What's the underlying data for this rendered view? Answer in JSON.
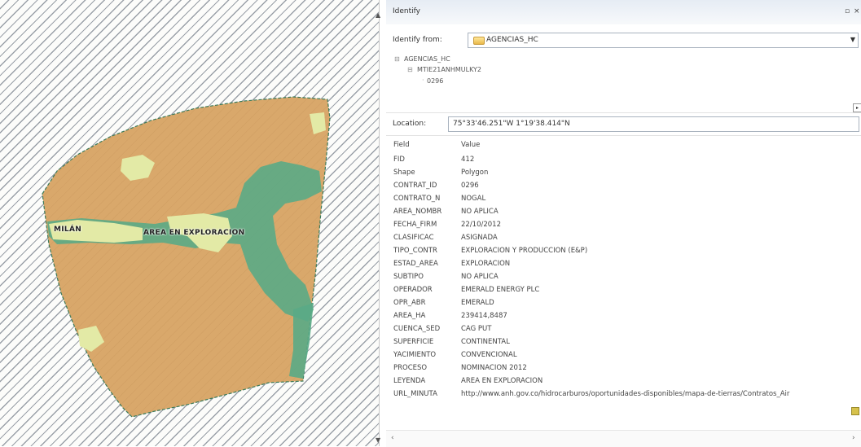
{
  "map": {
    "labels": {
      "milan": "MILÁN",
      "area": "AREA EN EXPLORACION"
    },
    "colors": {
      "area_fill": "#d9a86b",
      "green": "#5aaa86",
      "light_green": "#e3eaa6",
      "hatch": "#9aa0a8"
    }
  },
  "panel": {
    "title": "Identify",
    "pin_icon": "pin-icon",
    "close_icon": "close-icon",
    "identify_from_label": "Identify from:",
    "identify_from_value": "AGENCIAS_HC",
    "tree": {
      "layer": "AGENCIAS_HC",
      "feature": "MTIE21ANHMULKY2",
      "value": "0296"
    },
    "location_label": "Location:",
    "location_value": "75°33'46.251\"W  1°19'38.414\"N",
    "table": {
      "header": {
        "field": "Field",
        "value": "Value"
      },
      "rows": [
        {
          "field": "FID",
          "value": "412"
        },
        {
          "field": "Shape",
          "value": "Polygon"
        },
        {
          "field": "CONTRAT_ID",
          "value": "0296"
        },
        {
          "field": "CONTRATO_N",
          "value": "NOGAL"
        },
        {
          "field": "AREA_NOMBR",
          "value": "NO APLICA"
        },
        {
          "field": "FECHA_FIRM",
          "value": "22/10/2012"
        },
        {
          "field": "CLASIFICAC",
          "value": "ASIGNADA"
        },
        {
          "field": "TIPO_CONTR",
          "value": "EXPLORACION Y PRODUCCION (E&P)"
        },
        {
          "field": "ESTAD_AREA",
          "value": "EXPLORACION"
        },
        {
          "field": "SUBTIPO",
          "value": "NO APLICA"
        },
        {
          "field": "OPERADOR",
          "value": "EMERALD ENERGY PLC"
        },
        {
          "field": "OPR_ABR",
          "value": "EMERALD"
        },
        {
          "field": "AREA_HA",
          "value": "239414,8487"
        },
        {
          "field": "CUENCA_SED",
          "value": "CAG PUT"
        },
        {
          "field": "SUPERFICIE",
          "value": "CONTINENTAL"
        },
        {
          "field": "YACIMIENTO",
          "value": "CONVENCIONAL"
        },
        {
          "field": "PROCESO",
          "value": "NOMINACION 2012"
        },
        {
          "field": "LEYENDA",
          "value": "AREA EN EXPLORACION"
        },
        {
          "field": "URL_MINUTA",
          "value": "http://www.anh.gov.co/hidrocarburos/oportunidades-disponibles/mapa-de-tierras/Contratos_Air"
        }
      ]
    }
  }
}
